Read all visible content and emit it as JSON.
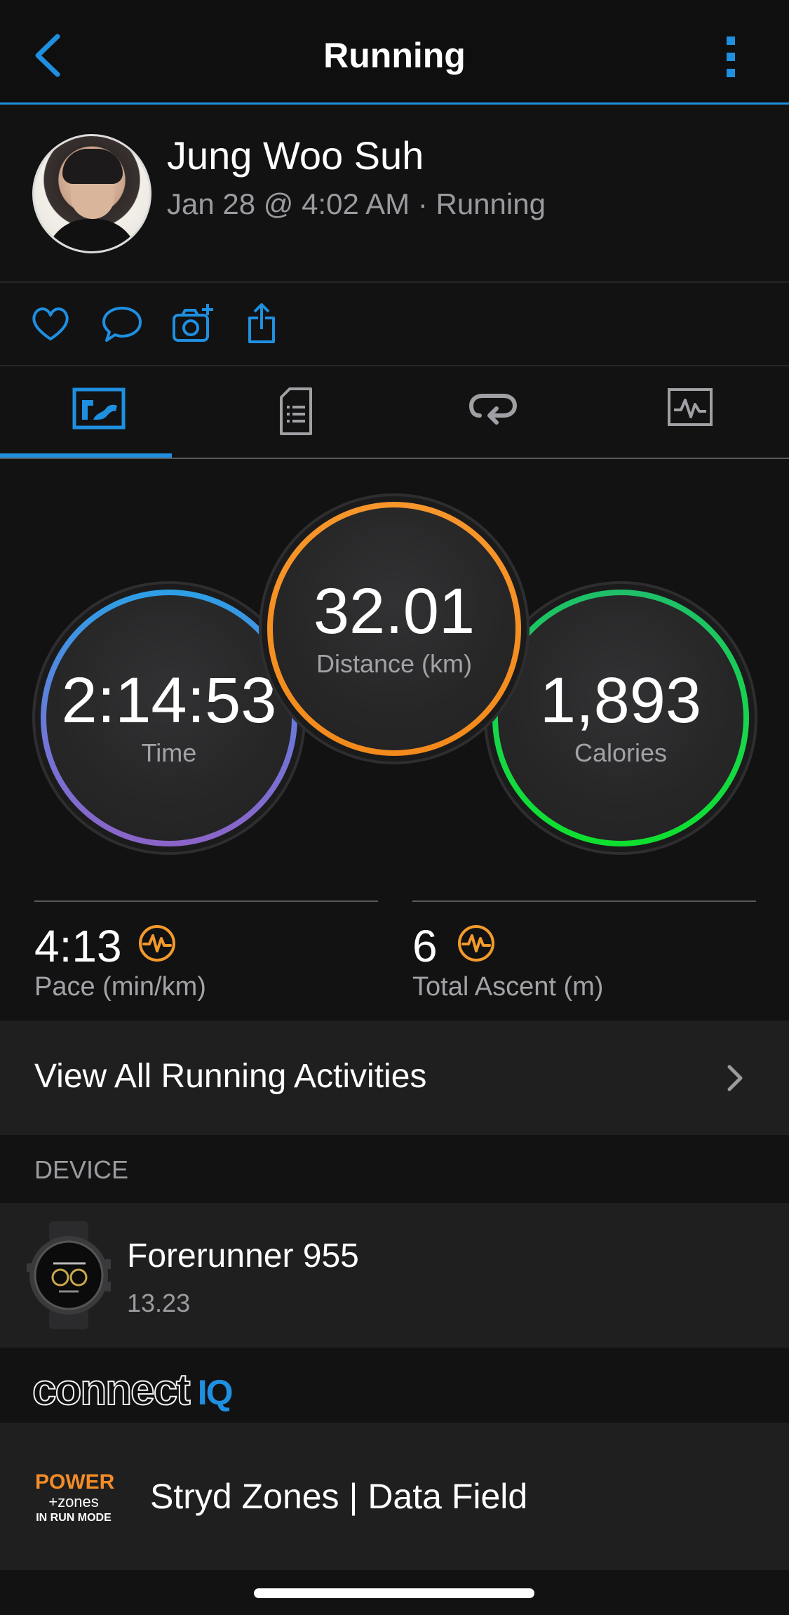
{
  "header": {
    "title": "Running",
    "accent": "#1f8fe0"
  },
  "profile": {
    "name": "Jung Woo Suh",
    "meta": "Jan 28 @ 4:02 AM · Running"
  },
  "actions": [
    {
      "icon": "heart-icon"
    },
    {
      "icon": "comment-icon"
    },
    {
      "icon": "add-photo-icon"
    },
    {
      "icon": "share-icon"
    }
  ],
  "tabs": [
    {
      "icon": "overview-tab-icon",
      "active": true
    },
    {
      "icon": "details-tab-icon",
      "active": false
    },
    {
      "icon": "laps-tab-icon",
      "active": false
    },
    {
      "icon": "charts-tab-icon",
      "active": false
    }
  ],
  "summary": {
    "time": {
      "value": "2:14:53",
      "label": "Time"
    },
    "distance": {
      "value": "32.01",
      "label": "Distance (km)"
    },
    "calories": {
      "value": "1,893",
      "label": "Calories"
    }
  },
  "stats": {
    "pace": {
      "value": "4:13",
      "label": "Pace (min/km)"
    },
    "ascent": {
      "value": "6",
      "label": "Total Ascent (m)"
    }
  },
  "view_all": {
    "label": "View All Running Activities"
  },
  "device": {
    "section_label": "DEVICE",
    "name": "Forerunner 955",
    "version": "13.23"
  },
  "connect_iq": {
    "brand_text": "connect",
    "brand_suffix": "IQ"
  },
  "apps": [
    {
      "name": "Stryd Zones | Data Field",
      "logo_lines": [
        "POWER",
        "+zones",
        "IN RUN MODE"
      ]
    }
  ],
  "colors": {
    "time_ring": "#6d78d9",
    "distance_ring": "#f38a1b",
    "calories_ring": "#17d64a",
    "stat_icon": "#f39a2b"
  }
}
